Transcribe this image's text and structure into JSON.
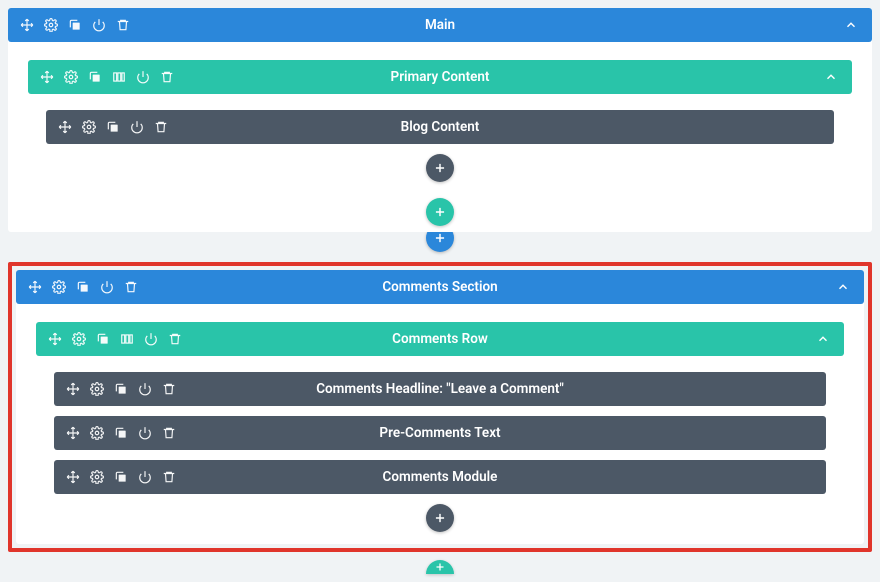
{
  "colors": {
    "blue": "#2b87da",
    "green": "#29c4a9",
    "dark": "#4c5866",
    "highlight": "#e0352b"
  },
  "icons": {
    "move": "move-icon",
    "gear": "gear-icon",
    "duplicate": "duplicate-icon",
    "columns": "columns-icon",
    "power": "power-icon",
    "trash": "trash-icon",
    "collapse": "chevron-up-icon",
    "add": "plus-icon"
  },
  "sections": [
    {
      "id": "main",
      "title": "Main",
      "highlight": false,
      "rows": [
        {
          "id": "primary",
          "title": "Primary Content",
          "modules": [
            {
              "id": "blog",
              "title": "Blog Content"
            }
          ]
        }
      ]
    },
    {
      "id": "comments",
      "title": "Comments Section",
      "highlight": true,
      "rows": [
        {
          "id": "comments-row",
          "title": "Comments Row",
          "modules": [
            {
              "id": "headline",
              "title": "Comments Headline: \"Leave a Comment\""
            },
            {
              "id": "pretext",
              "title": "Pre-Comments Text"
            },
            {
              "id": "module",
              "title": "Comments Module"
            }
          ]
        }
      ]
    }
  ]
}
